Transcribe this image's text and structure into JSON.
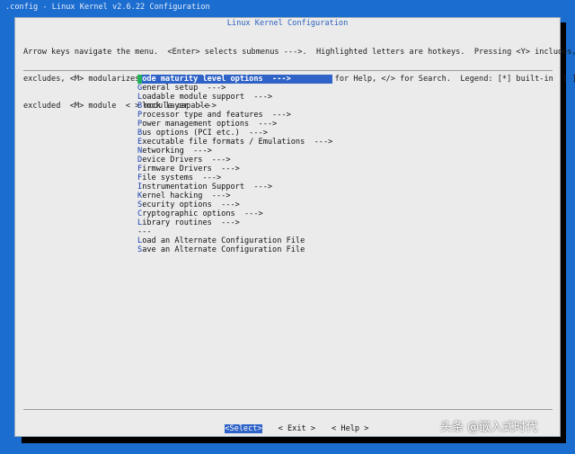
{
  "backtitle": ".config - Linux Kernel v2.6.22 Configuration",
  "dialog_title": "Linux Kernel Configuration",
  "help_lines": [
    "Arrow keys navigate the menu.  <Enter> selects submenus --->.  Highlighted letters are hotkeys.  Pressing <Y> includes, <N>",
    "excludes, <M> modularizes features.  Press <Esc><Esc> to exit, <?> for Help, </> for Search.  Legend: [*] built-in  [ ]",
    "excluded  <M> module  < > module capable"
  ],
  "menu_items": [
    {
      "hot": "C",
      "rest": "ode maturity level options  --->",
      "selected": true
    },
    {
      "hot": "G",
      "rest": "eneral setup  --->"
    },
    {
      "hot": "L",
      "rest": "oadable module support  --->"
    },
    {
      "hot": "B",
      "rest": "lock layer  --->"
    },
    {
      "hot": "P",
      "rest": "rocessor type and features  --->"
    },
    {
      "hot": "P",
      "rest": "ower management options  --->"
    },
    {
      "hot": "B",
      "rest": "us options (PCI etc.)  --->"
    },
    {
      "hot": "E",
      "rest": "xecutable file formats / Emulations  --->"
    },
    {
      "hot": "N",
      "rest": "etworking  --->"
    },
    {
      "hot": "D",
      "rest": "evice Drivers  --->"
    },
    {
      "hot": "F",
      "rest": "irmware Drivers  --->"
    },
    {
      "hot": "F",
      "rest": "ile systems  --->"
    },
    {
      "hot": "I",
      "rest": "nstrumentation Support  --->"
    },
    {
      "hot": "K",
      "rest": "ernel hacking  --->"
    },
    {
      "hot": "S",
      "rest": "ecurity options  --->"
    },
    {
      "hot": "C",
      "rest": "ryptographic options  --->"
    },
    {
      "hot": "L",
      "rest": "ibrary routines  --->"
    },
    {
      "separator": "---"
    },
    {
      "hot": "L",
      "rest": "oad an Alternate Configuration File"
    },
    {
      "hot": "S",
      "rest": "ave an Alternate Configuration File"
    }
  ],
  "buttons": {
    "select": "<Select>",
    "exit": "< Exit >",
    "help": "< Help >"
  },
  "watermark": "头条 @嵌入式时代"
}
